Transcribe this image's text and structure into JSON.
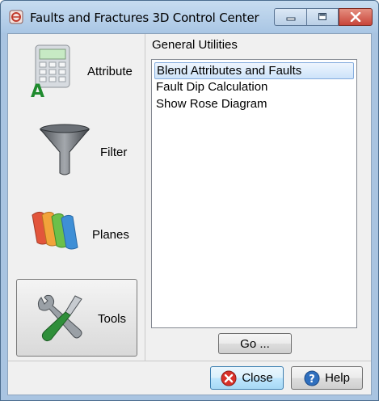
{
  "window": {
    "title": "Faults and Fractures 3D Control Center",
    "controls": [
      "minimize",
      "maximize",
      "close"
    ]
  },
  "sidebar": {
    "items": [
      {
        "label": "Attribute",
        "icon": "calculator-icon",
        "active": false
      },
      {
        "label": "Filter",
        "icon": "funnel-icon",
        "active": false
      },
      {
        "label": "Planes",
        "icon": "planes-icon",
        "active": false
      },
      {
        "label": "Tools",
        "icon": "tools-icon",
        "active": true
      }
    ]
  },
  "main": {
    "group_label": "General Utilities",
    "list": [
      {
        "label": "Blend Attributes and Faults",
        "selected": true
      },
      {
        "label": "Fault Dip Calculation",
        "selected": false
      },
      {
        "label": "Show Rose Diagram",
        "selected": false
      }
    ],
    "go_label": "Go ..."
  },
  "footer": {
    "close_label": "Close",
    "help_label": "Help"
  },
  "colors": {
    "title_bar": "#b8d1ea",
    "close_caption": "#c8453a",
    "selection": "#cde3fa",
    "close_icon": "#d8322a",
    "help_icon": "#2f6fbe"
  }
}
